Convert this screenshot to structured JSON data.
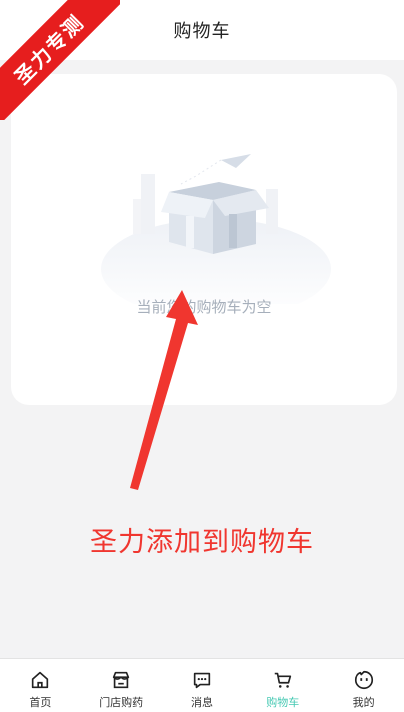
{
  "header": {
    "title": "购物车"
  },
  "ribbon": {
    "text": "圣力专测"
  },
  "cart": {
    "empty_text": "当前您的购物车为空"
  },
  "promo": {
    "text": "圣力添加到购物车"
  },
  "tabbar": {
    "items": [
      {
        "label": "首页",
        "icon": "home-icon"
      },
      {
        "label": "门店购药",
        "icon": "store-icon"
      },
      {
        "label": "消息",
        "icon": "message-icon"
      },
      {
        "label": "购物车",
        "icon": "cart-icon",
        "active": true
      },
      {
        "label": "我的",
        "icon": "profile-icon"
      }
    ]
  },
  "colors": {
    "accent": "#46c9b3",
    "annotation_red": "#f0362f",
    "ribbon": "#e61e1e"
  }
}
